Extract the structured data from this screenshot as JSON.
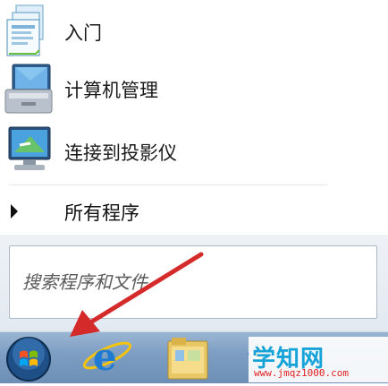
{
  "menu": {
    "items": [
      {
        "label": "入门",
        "icon": "getting-started-icon"
      },
      {
        "label": "计算机管理",
        "icon": "computer-management-icon"
      },
      {
        "label": "连接到投影仪",
        "icon": "projector-icon"
      }
    ],
    "all_programs": {
      "label": "所有程序",
      "icon": "triangle-right-icon"
    }
  },
  "search": {
    "placeholder": "搜索程序和文件"
  },
  "taskbar": {
    "items": [
      "start-orb-icon",
      "internet-explorer-icon",
      "folder-icon",
      "app-icon"
    ]
  },
  "watermark": {
    "logo": "学知网",
    "url": "www.jmqz1000.com"
  },
  "colors": {
    "accent_arrow": "#d42a2a",
    "taskbar": "#7e9fc3",
    "watermark_blue": "#16a3d8"
  }
}
